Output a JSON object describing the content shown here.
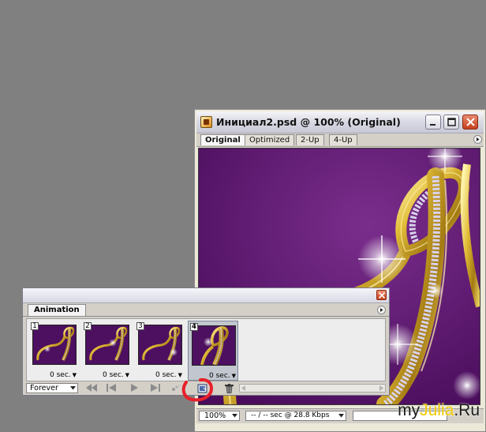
{
  "doc_window": {
    "title": "Инициал2.psd @ 100% (Original)",
    "tabs": [
      {
        "label": "Original",
        "active": true
      },
      {
        "label": "Optimized",
        "active": false
      },
      {
        "label": "2-Up",
        "active": false
      },
      {
        "label": "4-Up",
        "active": false
      }
    ],
    "icon": "photoshop-doc-icon"
  },
  "status_bar": {
    "zoom": "100%",
    "speed": "-- / -- sec @ 28.8 Kbps"
  },
  "animation_panel": {
    "tab_label": "Animation",
    "frames": [
      {
        "number": "1",
        "delay": "0 sec.",
        "selected": false
      },
      {
        "number": "2",
        "delay": "0 sec.",
        "selected": false
      },
      {
        "number": "3",
        "delay": "0 sec.",
        "selected": false
      },
      {
        "number": "4",
        "delay": "0 sec.",
        "selected": true
      }
    ],
    "loop_option": "Forever",
    "controls": [
      "first-frame-icon",
      "previous-frame-icon",
      "play-icon",
      "next-frame-icon",
      "tween-icon",
      "new-frame-icon",
      "trash-icon"
    ]
  },
  "watermark": {
    "prefix": "my",
    "accent": "Julia",
    "suffix": ".Ru"
  },
  "colors": {
    "desktop": "#808080",
    "canvas": "#4d1060",
    "gold": "#d9b431",
    "highlight_mark": "#e8202a"
  }
}
